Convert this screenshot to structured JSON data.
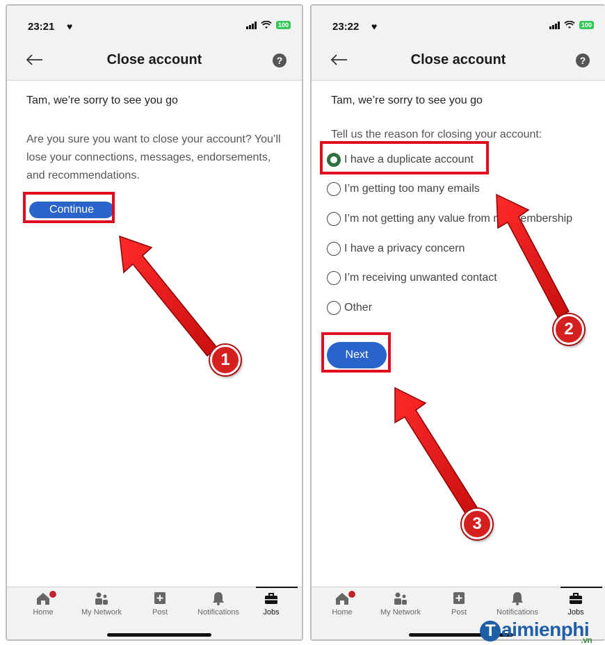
{
  "left_screen": {
    "status": {
      "time": "23:21",
      "battery": "100"
    },
    "header": {
      "title": "Close account"
    },
    "greeting": "Tam, we’re sorry to see you go",
    "description": "Are you sure you want to close your account? You’ll lose your connections, messages, endorsements, and recommendations.",
    "continue_label": "Continue"
  },
  "right_screen": {
    "status": {
      "time": "23:22",
      "battery": "100"
    },
    "header": {
      "title": "Close account"
    },
    "greeting": "Tam, we’re sorry to see you go",
    "reason_label": "Tell us the reason for closing your account:",
    "reasons": [
      {
        "label": "I have a duplicate account",
        "checked": true
      },
      {
        "label": "I’m getting too many emails",
        "checked": false
      },
      {
        "label": "I’m not getting any value from my membership",
        "checked": false
      },
      {
        "label": "I have a privacy concern",
        "checked": false
      },
      {
        "label": "I’m receiving unwanted contact",
        "checked": false
      },
      {
        "label": "Other",
        "checked": false
      }
    ],
    "next_label": "Next"
  },
  "bottom_nav": {
    "items": [
      {
        "label": "Home",
        "icon": "home-icon"
      },
      {
        "label": "My Network",
        "icon": "network-icon"
      },
      {
        "label": "Post",
        "icon": "post-icon"
      },
      {
        "label": "Notifications",
        "icon": "bell-icon"
      },
      {
        "label": "Jobs",
        "icon": "briefcase-icon",
        "active": true
      }
    ]
  },
  "annotations": {
    "step1": "1",
    "step2": "2",
    "step3": "3"
  },
  "watermark": {
    "letter": "T",
    "text": "aimienphi",
    "suffix": ".vn"
  },
  "colors": {
    "primary_button": "#2a63c9",
    "selected_radio": "#2f6f3e",
    "highlight_box": "#e10d1f",
    "badge": "#c0232a"
  }
}
